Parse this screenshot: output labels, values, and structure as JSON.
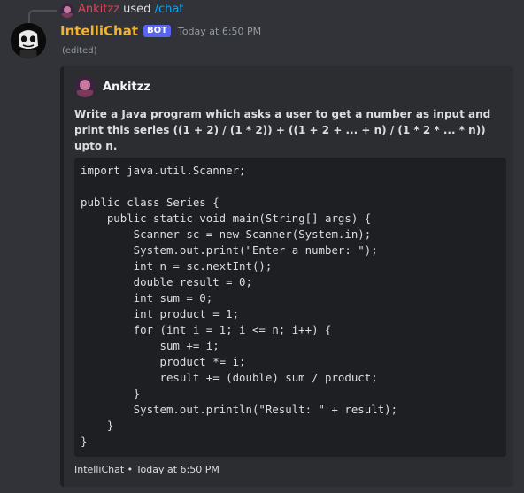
{
  "reply": {
    "author": "Ankitzz",
    "used_text": "used",
    "command": "/chat"
  },
  "message": {
    "author": "IntelliChat",
    "tag": "BOT",
    "timestamp": "Today at 6:50 PM",
    "edited": "(edited)"
  },
  "embed": {
    "author": "Ankitzz",
    "description": "Write a Java program which asks a user to get a number as input and print this series ((1 + 2) / (1 * 2)) + ((1 + 2 + ... + n) / (1 * 2 * ... * n)) upto n.",
    "code": "import java.util.Scanner;\n\npublic class Series {\n    public static void main(String[] args) {\n        Scanner sc = new Scanner(System.in);\n        System.out.print(\"Enter a number: \");\n        int n = sc.nextInt();\n        double result = 0;\n        int sum = 0;\n        int product = 1;\n        for (int i = 1; i <= n; i++) {\n            sum += i;\n            product *= i;\n            result += (double) sum / product;\n        }\n        System.out.println(\"Result: \" + result);\n    }\n}",
    "footer": "IntelliChat • Today at 6:50 PM"
  },
  "colors": {
    "background": "#313338",
    "bot_name": "#f0b232",
    "reply_author": "#e0435a",
    "command": "#00a8fc",
    "bot_tag": "#5865f2"
  }
}
